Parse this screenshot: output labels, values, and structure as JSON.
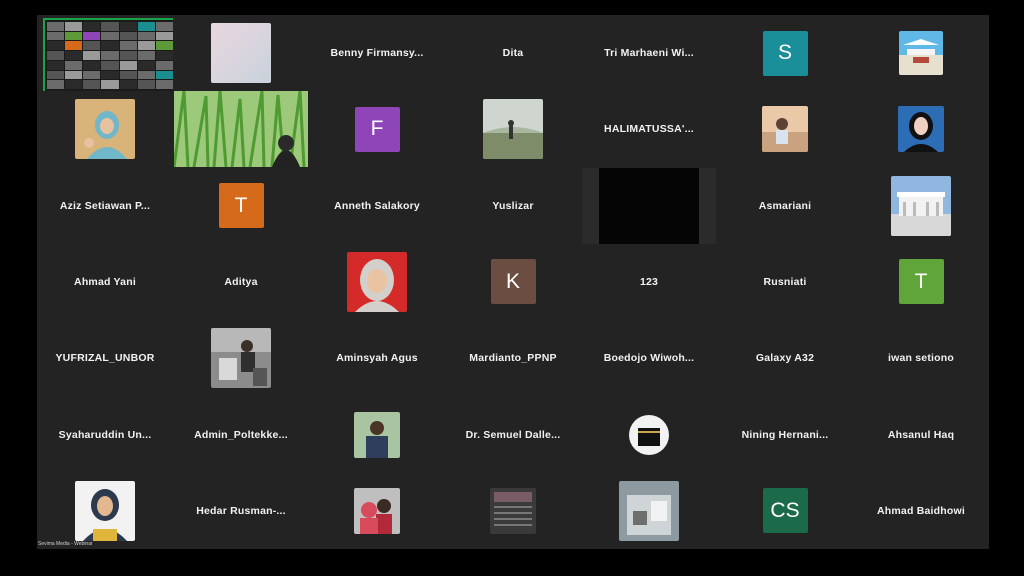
{
  "meeting": {
    "footer_label": "Sevima Media - Webinar"
  },
  "colors": {
    "tile_bg": "#232323",
    "avatar_S": "#1b8f99",
    "avatar_F": "#8e45b8",
    "avatar_T_orange": "#d66a1b",
    "avatar_K": "#6b4e41",
    "avatar_T_green": "#5fa53a",
    "avatar_CS": "#1b6b4a",
    "active_speaker_border": "#1aa34a"
  },
  "tiles": {
    "r1": {
      "c3": "Benny  Firmansy...",
      "c4": "Dita",
      "c5": "Tri  Marhaeni  Wi...",
      "c6_initial": "S"
    },
    "r2": {
      "c3_initial": "F",
      "c5": "HALIMATUSSA'..."
    },
    "r3": {
      "c1": "Aziz  Setiawan  P...",
      "c2_initial": "T",
      "c3": "Anneth  Salakory",
      "c4": "Yuslizar",
      "c6": "Asmariani"
    },
    "r4": {
      "c1": "Ahmad  Yani",
      "c2": "Aditya",
      "c4_initial": "K",
      "c5": "123",
      "c6": "Rusniati",
      "c7_initial": "T"
    },
    "r5": {
      "c1": "YUFRIZAL_UNBOR",
      "c3": "Aminsyah  Agus",
      "c4": "Mardianto_PPNP",
      "c5": "Boedojo  Wiwoh...",
      "c6": "Galaxy  A32",
      "c7": "iwan  setiono"
    },
    "r6": {
      "c1": "Syaharuddin  Un...",
      "c2": "Admin_Poltekke...",
      "c4": "Dr.  Semuel  Dalle...",
      "c6": "Nining  Hernani...",
      "c7": "Ahsanul  Haq"
    },
    "r7": {
      "c2": "Hedar  Rusman-...",
      "c6_initial": "CS",
      "c7": "Ahmad  Baidhowi"
    }
  }
}
